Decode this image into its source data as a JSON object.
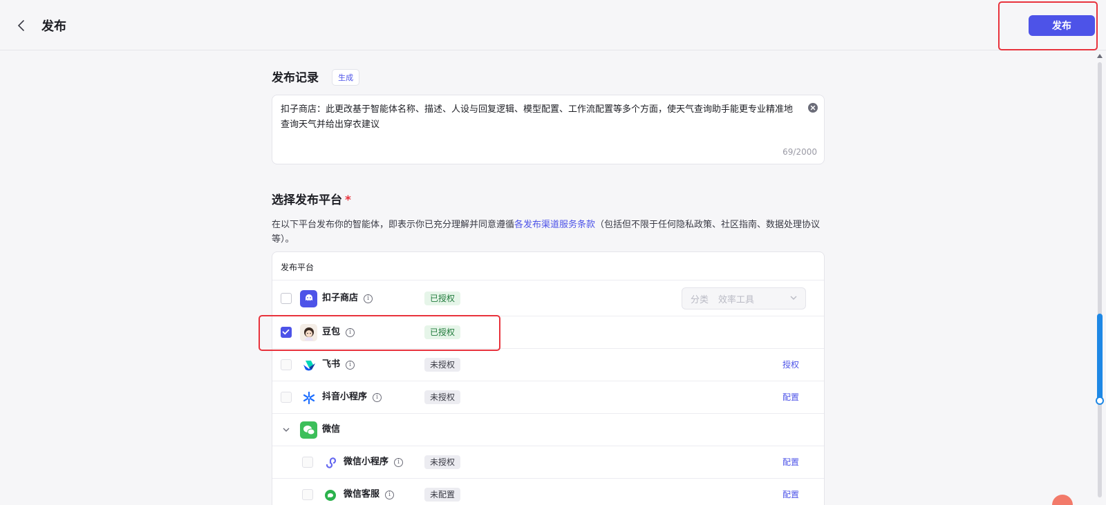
{
  "header": {
    "title": "发布",
    "publish_label": "发布"
  },
  "record": {
    "title": "发布记录",
    "generate_label": "生成",
    "text": "扣子商店：此更改基于智能体名称、描述、人设与回复逻辑、模型配置、工作流配置等多个方面，使天气查询助手能更专业精准地查询天气并给出穿衣建议",
    "counter": "69/2000"
  },
  "platforms": {
    "title": "选择发布平台",
    "required_mark": "*",
    "desc_prefix": "在以下平台发布你的智能体，即表示你已充分理解并同意遵循",
    "desc_link": "各发布渠道服务条款",
    "desc_suffix": "（包括但不限于任何隐私政策、社区指南、数据处理协议等）。",
    "column_header": "发布平台",
    "rows": [
      {
        "name": "扣子商店",
        "status": "已授权",
        "checked": false,
        "category_label": "分类",
        "category_value": "效率工具"
      },
      {
        "name": "豆包",
        "status": "已授权",
        "checked": true
      },
      {
        "name": "飞书",
        "status": "未授权",
        "checked": false,
        "action": "授权"
      },
      {
        "name": "抖音小程序",
        "status": "未授权",
        "checked": false,
        "action": "配置"
      },
      {
        "name": "微信",
        "group": true
      },
      {
        "name": "微信小程序",
        "status": "未授权",
        "checked": false,
        "action": "配置"
      },
      {
        "name": "微信客服",
        "status": "未配置",
        "checked": false,
        "action": "配置"
      }
    ]
  },
  "colors": {
    "accent": "#4d53e8",
    "highlight": "#e8323c",
    "authorized_bg": "#e6f5e9",
    "authorized_text": "#1f7a3a"
  },
  "icons": {
    "back": "chevron-left-icon",
    "clear": "clear-circle-icon",
    "info": "info-icon",
    "dropdown": "chevron-down-icon",
    "expand": "chevron-down-icon"
  }
}
